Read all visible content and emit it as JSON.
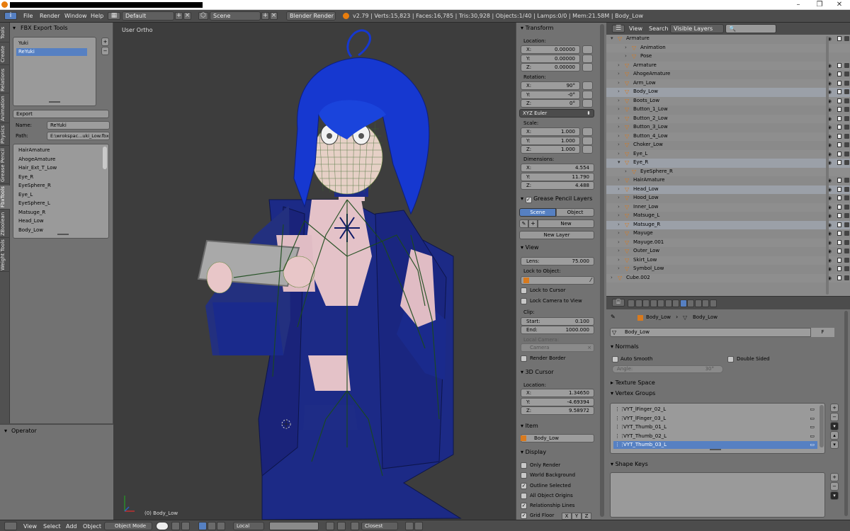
{
  "topbar": {
    "menus": [
      "File",
      "Render",
      "Window",
      "Help"
    ],
    "layout": "Default",
    "scene": "Scene",
    "engine": "Blender Render",
    "stats": "v2.79 | Verts:15,823 | Faces:16,785 | Tris:30,928 | Objects:1/40 | Lamps:0/0 | Mem:21.58M | Body_Low"
  },
  "tabs": [
    "Tools",
    "Create",
    "Relations",
    "Animation",
    "Physics",
    "Grease Pencil",
    "FbxTools",
    "ZBoolean",
    "Weight Tools"
  ],
  "toolshelf": {
    "title": "FBX Export Tools",
    "list_items": [
      "Yuki",
      "ReYuki"
    ],
    "selected_index": 1,
    "export_label": "Export",
    "name_label": "Name:",
    "name_value": "ReYuki",
    "path_label": "Path:",
    "path_value": "E:\\wrokspac...uki_Low.fbx",
    "bones": [
      "HairAmature",
      "AhogeAmature",
      "Hair_Ext_T_Low",
      "Eye_R",
      "EyeSphere_R",
      "Eye_L",
      "EyeSphere_L",
      "Matsuge_R",
      "Head_Low",
      "Body_Low"
    ]
  },
  "operator": {
    "title": "Operator"
  },
  "viewport": {
    "view_label": "User Ortho",
    "object_label": "(0) Body_Low"
  },
  "npanel": {
    "transform": "Transform",
    "location_label": "Location:",
    "location": [
      [
        "X:",
        "0.00000"
      ],
      [
        "Y:",
        "0.00000"
      ],
      [
        "Z:",
        "0.00000"
      ]
    ],
    "rotation_label": "Rotation:",
    "rotation": [
      [
        "X:",
        "90°"
      ],
      [
        "Y:",
        "-0°"
      ],
      [
        "Z:",
        "0°"
      ]
    ],
    "euler": "XYZ Euler",
    "scale_label": "Scale:",
    "scale": [
      [
        "X:",
        "1.000"
      ],
      [
        "Y:",
        "1.000"
      ],
      [
        "Z:",
        "1.000"
      ]
    ],
    "dimensions_label": "Dimensions:",
    "dimensions": [
      [
        "X:",
        "4.554"
      ],
      [
        "Y:",
        "11.790"
      ],
      [
        "Z:",
        "4.488"
      ]
    ],
    "grease_pencil": "Grease Pencil Layers",
    "gp_scene": "Scene",
    "gp_object": "Object",
    "gp_new": "New",
    "gp_new_layer": "New Layer",
    "view": "View",
    "lens_label": "Lens:",
    "lens_value": "75.000",
    "lock_to_object": "Lock to Object:",
    "lock_to_cursor": "Lock to Cursor",
    "lock_camera": "Lock Camera to View",
    "clip": "Clip:",
    "clip_start_label": "Start:",
    "clip_start": "0.100",
    "clip_end_label": "End:",
    "clip_end": "1000.000",
    "local_camera": "Local Camera:",
    "camera": "Camera",
    "render_border": "Render Border",
    "cursor": "3D Cursor",
    "cursor_location_label": "Location:",
    "cursor_location": [
      [
        "X:",
        "1.34650"
      ],
      [
        "Y:",
        "-4.69394"
      ],
      [
        "Z:",
        "9.58972"
      ]
    ],
    "item": "Item",
    "item_name": "Body_Low",
    "display": "Display",
    "only_render": "Only Render",
    "world_background": "World Background",
    "outline_selected": "Outline Selected",
    "all_object_origins": "All Object Origins",
    "relationship_lines": "Relationship Lines",
    "grid_floor": "Grid Floor",
    "axes": [
      "X",
      "Y",
      "Z"
    ]
  },
  "outliner": {
    "view": "View",
    "search": "Search",
    "display_mode": "Visible Layers",
    "rows": [
      {
        "label": "Armature",
        "indent": 0
      },
      {
        "label": "Animation",
        "indent": 2
      },
      {
        "label": "Pose",
        "indent": 2
      },
      {
        "label": "Armature",
        "indent": 1
      },
      {
        "label": "AhogeAmature",
        "indent": 1
      },
      {
        "label": "Arm_Low",
        "indent": 1
      },
      {
        "label": "Body_Low",
        "indent": 1
      },
      {
        "label": "Boots_Low",
        "indent": 1
      },
      {
        "label": "Button_1_Low",
        "indent": 1
      },
      {
        "label": "Button_2_Low",
        "indent": 1
      },
      {
        "label": "Button_3_Low",
        "indent": 1
      },
      {
        "label": "Button_4_Low",
        "indent": 1
      },
      {
        "label": "Choker_Low",
        "indent": 1
      },
      {
        "label": "Eye_L",
        "indent": 1
      },
      {
        "label": "Eye_R",
        "indent": 1
      },
      {
        "label": "EyeSphere_R",
        "indent": 2
      },
      {
        "label": "HairAmature",
        "indent": 1
      },
      {
        "label": "Head_Low",
        "indent": 1
      },
      {
        "label": "Hood_Low",
        "indent": 1
      },
      {
        "label": "Inner_Low",
        "indent": 1
      },
      {
        "label": "Matsuge_L",
        "indent": 1
      },
      {
        "label": "Matsuge_R",
        "indent": 1
      },
      {
        "label": "Mayuge",
        "indent": 1
      },
      {
        "label": "Mayuge.001",
        "indent": 1
      },
      {
        "label": "Outer_Low",
        "indent": 1
      },
      {
        "label": "Skirt_Low",
        "indent": 1
      },
      {
        "label": "Symbol_Low",
        "indent": 1
      },
      {
        "label": "Cube.002",
        "indent": 0
      }
    ]
  },
  "properties": {
    "breadcrumb_obj": "Body_Low",
    "breadcrumb_mesh": "Body_Low",
    "mesh_name": "Body_Low",
    "fake_user": "F",
    "normals": "Normals",
    "auto_smooth": "Auto Smooth",
    "double_sided": "Double Sided",
    "angle_label": "Angle:",
    "angle_value": "30°",
    "texture_space": "Texture Space",
    "vertex_groups": "Vertex Groups",
    "groups": [
      "VYT_lFinger_02_L",
      "VYT_lFinger_03_L",
      "VYT_Thumb_01_L",
      "VYT_Thumb_02_L",
      "VYT_Thumb_03_L"
    ],
    "group_selected": 4,
    "shape_keys": "Shape Keys"
  },
  "bottombar": {
    "menus": [
      "View",
      "Select",
      "Add",
      "Object"
    ],
    "mode": "Object Mode",
    "orientation": "Local",
    "snap": "Closest"
  },
  "colors": {
    "header": "#4c4c4c",
    "panel": "#727272",
    "viewport": "#3d3d3d",
    "selection": "#5680c2",
    "hair": "#1a3fd0",
    "outfit": "#1d2a7a",
    "skin": "#e8c8c8"
  }
}
